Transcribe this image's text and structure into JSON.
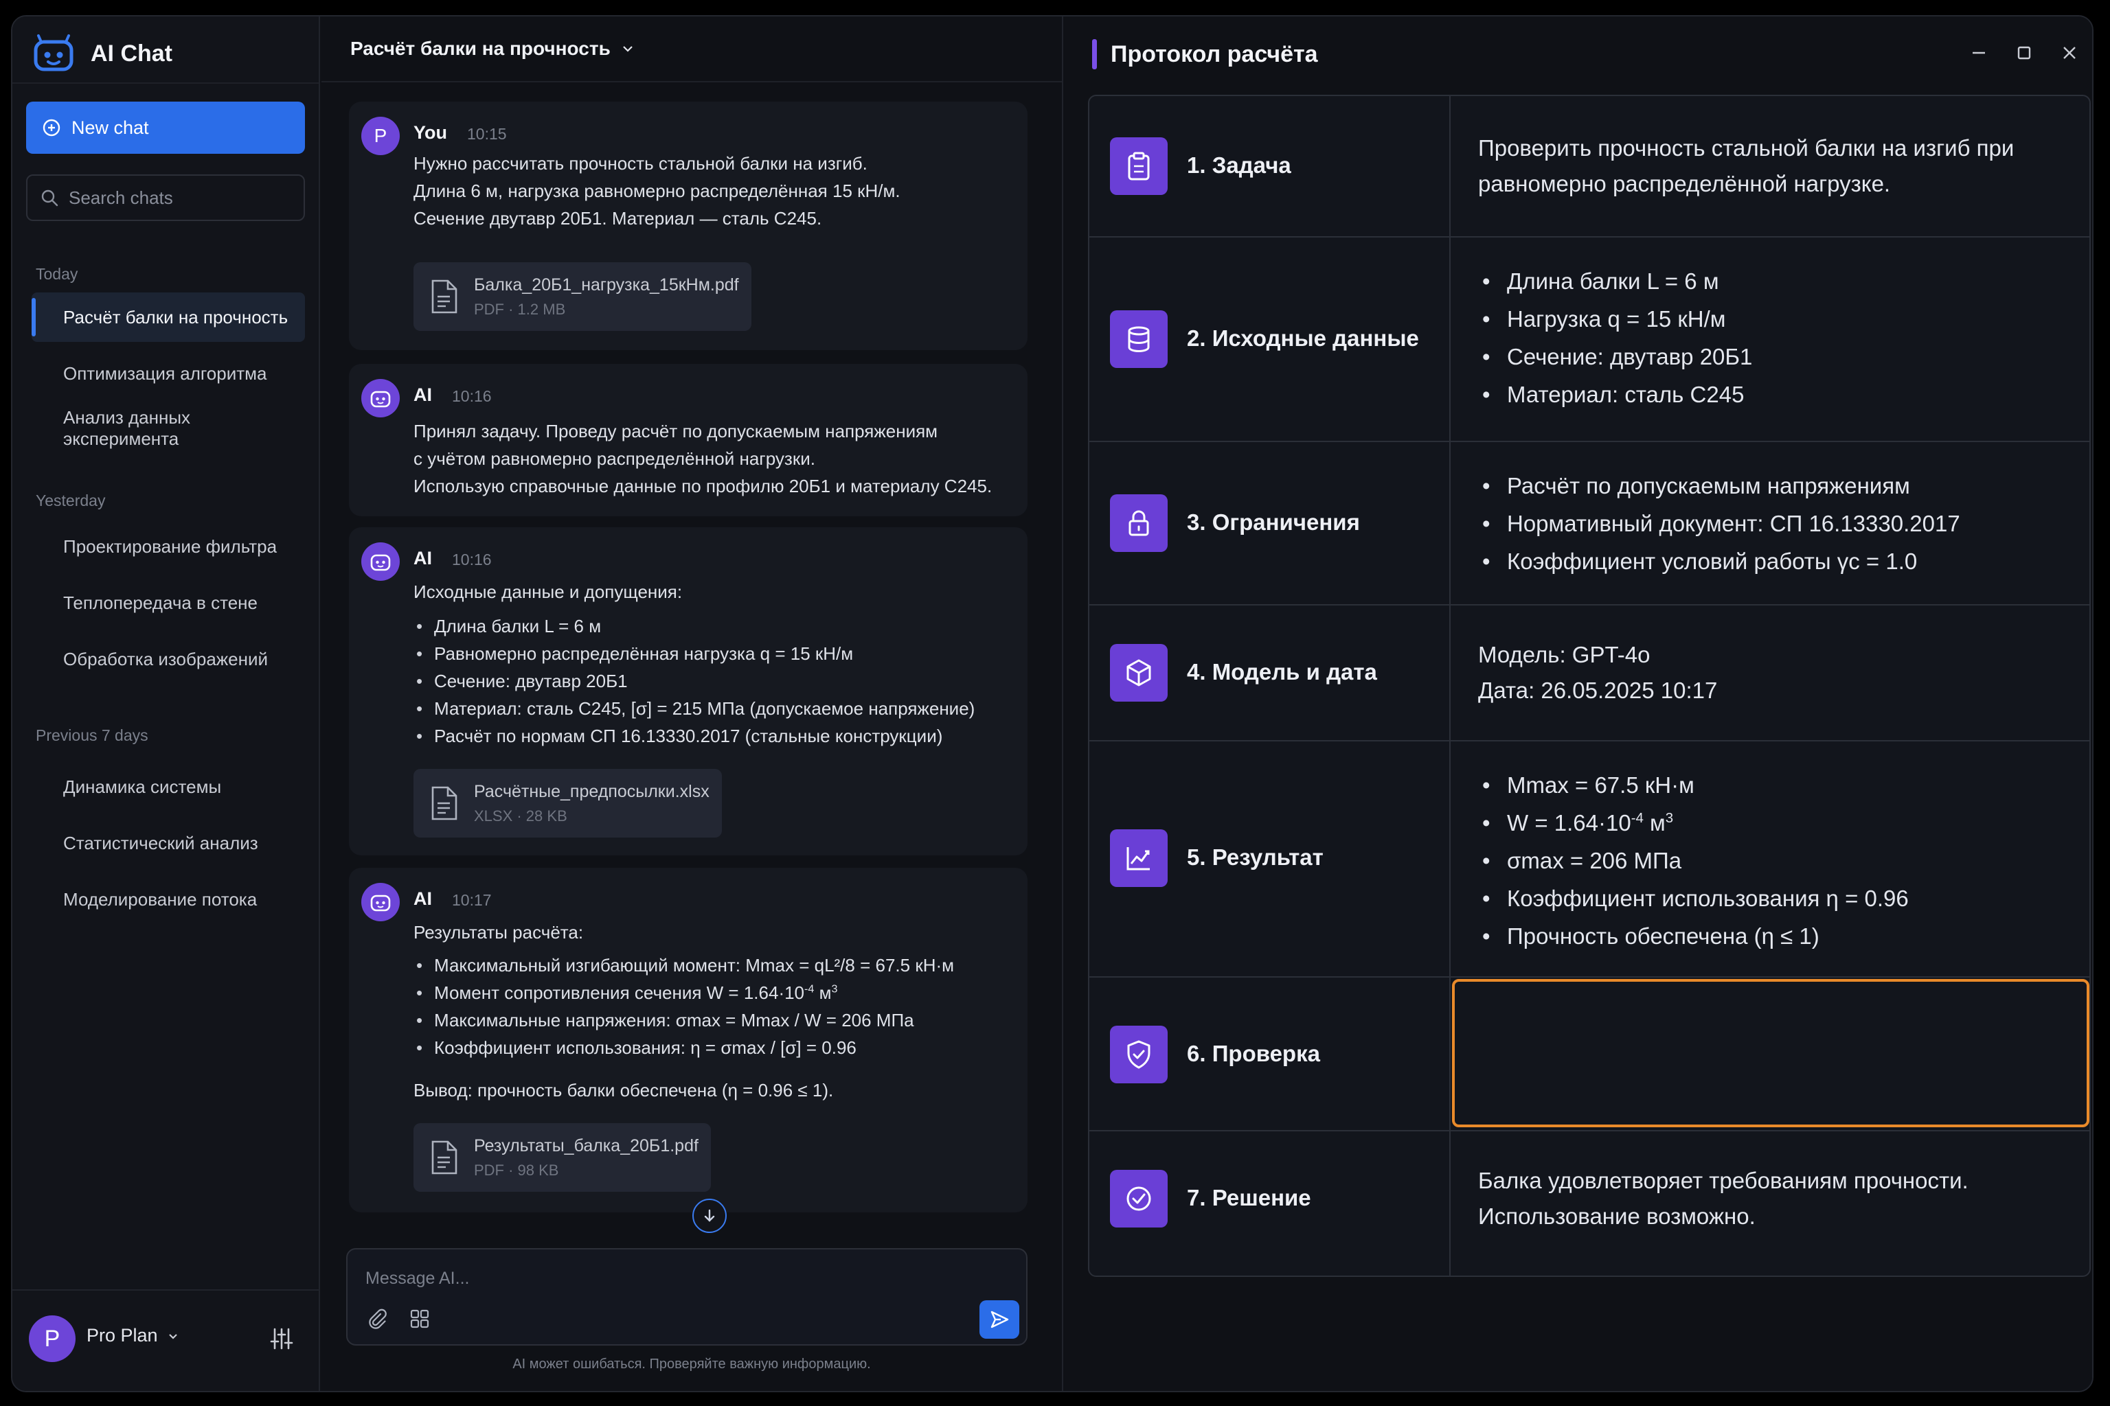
{
  "app": {
    "name": "AI Chat"
  },
  "sidebar": {
    "new_chat": "New chat",
    "search_placeholder": "Search chats",
    "sections": [
      {
        "label": "Today",
        "items": [
          "Расчёт балки на прочность",
          "Оптимизация алгоритма",
          "Анализ данных эксперимента"
        ]
      },
      {
        "label": "Yesterday",
        "items": [
          "Проектирование фильтра",
          "Теплопередача в стене",
          "Обработка изображений"
        ]
      },
      {
        "label": "Previous 7 days",
        "items": [
          "Динамика системы",
          "Статистический анализ",
          "Моделирование потока"
        ]
      }
    ],
    "active_item": "Расчёт балки на прочность",
    "user_initial": "P",
    "plan": "Pro Plan"
  },
  "chat": {
    "title": "Расчёт балки на прочность",
    "messages": [
      {
        "author": "You",
        "initial": "P",
        "time": "10:15",
        "lines": [
          "Нужно рассчитать прочность стальной балки на изгиб.",
          "Длина 6 м, нагрузка равномерно распределённая 15 кН/м.",
          "Сечение двутавр 20Б1. Материал — сталь С245."
        ],
        "attachment": {
          "name": "Балка_20Б1_нагрузка_15кНм.pdf",
          "meta": "PDF · 1.2 MB"
        }
      },
      {
        "author": "AI",
        "time": "10:16",
        "lines": [
          "Принял задачу. Проведу расчёт по допускаемым напряжениям",
          "с учётом равномерно распределённой нагрузки.",
          "Использую справочные данные по профилю 20Б1 и материалу С245."
        ]
      },
      {
        "author": "AI",
        "time": "10:16",
        "intro": "Исходные данные и допущения:",
        "bullets": [
          "Длина балки L = 6 м",
          "Равномерно распределённая нагрузка q = 15 кН/м",
          "Сечение: двутавр 20Б1",
          "Материал: сталь С245, [σ] = 215 МПа (допускаемое напряжение)",
          "Расчёт по нормам СП 16.13330.2017 (стальные конструкции)"
        ],
        "attachment": {
          "name": "Расчётные_предпосылки.xlsx",
          "meta": "XLSX · 28 KB"
        }
      },
      {
        "author": "AI",
        "time": "10:17",
        "intro": "Результаты расчёта:",
        "bullets": {
          "b1": "Максимальный изгибающий момент: Mmax = qL²/8 = 67.5 кН·м",
          "b2a": "Момент сопротивления сечения W = 1.64·10",
          "b2exp": "-4",
          "b2b": " м",
          "b2unit": "3",
          "b3": "Максимальные напряжения: σmax = Mmax / W = 206 МПа",
          "b4": "Коэффициент использования: η = σmax / [σ] = 0.96"
        },
        "conclusion": "Вывод: прочность балки обеспечена (η = 0.96 ≤ 1).",
        "attachment": {
          "name": "Результаты_балка_20Б1.pdf",
          "meta": "PDF · 98 KB"
        }
      }
    ],
    "composer_placeholder": "Message AI...",
    "disclaimer": "AI может ошибаться. Проверяйте важную информацию."
  },
  "protocol": {
    "title": "Протокол расчёта",
    "rows": [
      {
        "label": "1. Задача",
        "icon": "clipboard-icon",
        "lines": [
          "Проверить прочность стальной балки на изгиб при",
          "равномерно распределённой нагрузке."
        ]
      },
      {
        "label": "2. Исходные данные",
        "icon": "database-icon",
        "bullets": [
          "Длина балки L = 6 м",
          "Нагрузка q = 15 кН/м",
          "Сечение: двутавр 20Б1",
          "Материал: сталь С245"
        ]
      },
      {
        "label": "3. Ограничения",
        "icon": "lock-icon",
        "bullets": [
          "Расчёт по допускаемым напряжениям",
          "Нормативный документ: СП 16.13330.2017",
          "Коэффициент условий работы γc = 1.0"
        ]
      },
      {
        "label": "4. Модель и дата",
        "icon": "cube-icon",
        "lines": [
          "Модель: GPT-4o",
          "Дата: 26.05.2025 10:17"
        ]
      },
      {
        "label": "5. Результат",
        "icon": "chart-icon",
        "b1": "Mmax = 67.5 кН·м",
        "b2a": "W = 1.64·10",
        "b2exp": "-4",
        "b2b": " м",
        "b2unit": "3",
        "b3": "σmax = 206 МПа",
        "b4": "Коэффициент использования η = 0.96",
        "b5": "Прочность обеспечена (η ≤ 1)"
      },
      {
        "label": "6. Проверка",
        "icon": "shield-check-icon",
        "value": ""
      },
      {
        "label": "7. Решение",
        "icon": "check-circle-icon",
        "lines": [
          "Балка удовлетворяет требованиям прочности.",
          "Использование возможно."
        ]
      }
    ]
  },
  "colors": {
    "accent_blue": "#2b6de8",
    "accent_purple": "#6a3fd6",
    "highlight_orange": "#e98a2a"
  }
}
